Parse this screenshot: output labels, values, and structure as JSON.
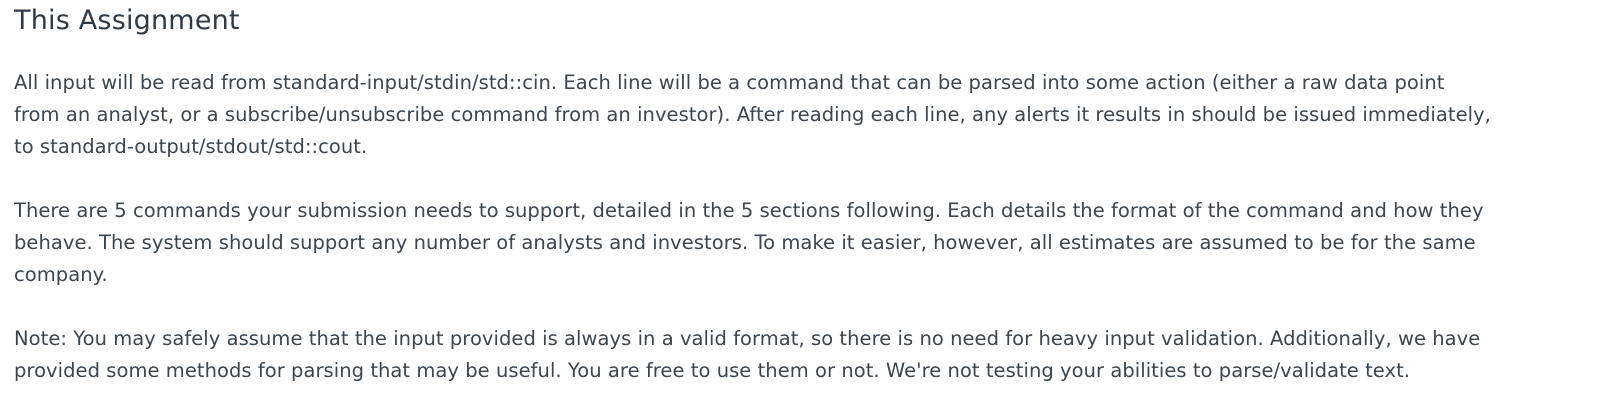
{
  "document": {
    "title": "This Assignment",
    "paragraphs": [
      {
        "lines": [
          "All input will be read from standard-input/stdin/std::cin. Each line will be a command that can be parsed into some action (either a raw data point",
          "from an analyst, or a subscribe/unsubscribe command from an investor). After reading each line, any alerts it results in should be issued immediately,",
          "to standard-output/stdout/std::cout."
        ]
      },
      {
        "lines": [
          "There are 5 commands your submission needs to support, detailed in the 5 sections following. Each details the format of the command and how they",
          "behave. The system should support any number of analysts and investors. To make it easier, however, all estimates are assumed to be for the same",
          "company."
        ]
      },
      {
        "lines": [
          "Note: You may safely assume that the input provided is always in a valid format, so there is no need for heavy input validation. Additionally, we have",
          "provided some methods for parsing that may be useful. You are free to use them or not. We're not testing your abilities to parse/validate text."
        ]
      }
    ]
  }
}
